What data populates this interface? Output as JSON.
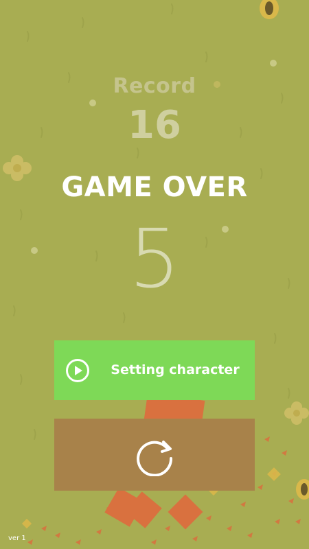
{
  "record": {
    "label": "Record",
    "value": "16"
  },
  "status": {
    "title": "GAME OVER"
  },
  "score": {
    "value": "5"
  },
  "buttons": {
    "setting_character_label": "Setting character",
    "setting_icon": "play-circle-icon",
    "restart_icon": "restart-arrow-icon"
  },
  "footer": {
    "version": "ver 1"
  },
  "colors": {
    "background": "#a8ad52",
    "setting_button": "#7ed957",
    "restart_button": "#a8824a",
    "block": "#d9713f",
    "flower": "#e8d77a"
  }
}
